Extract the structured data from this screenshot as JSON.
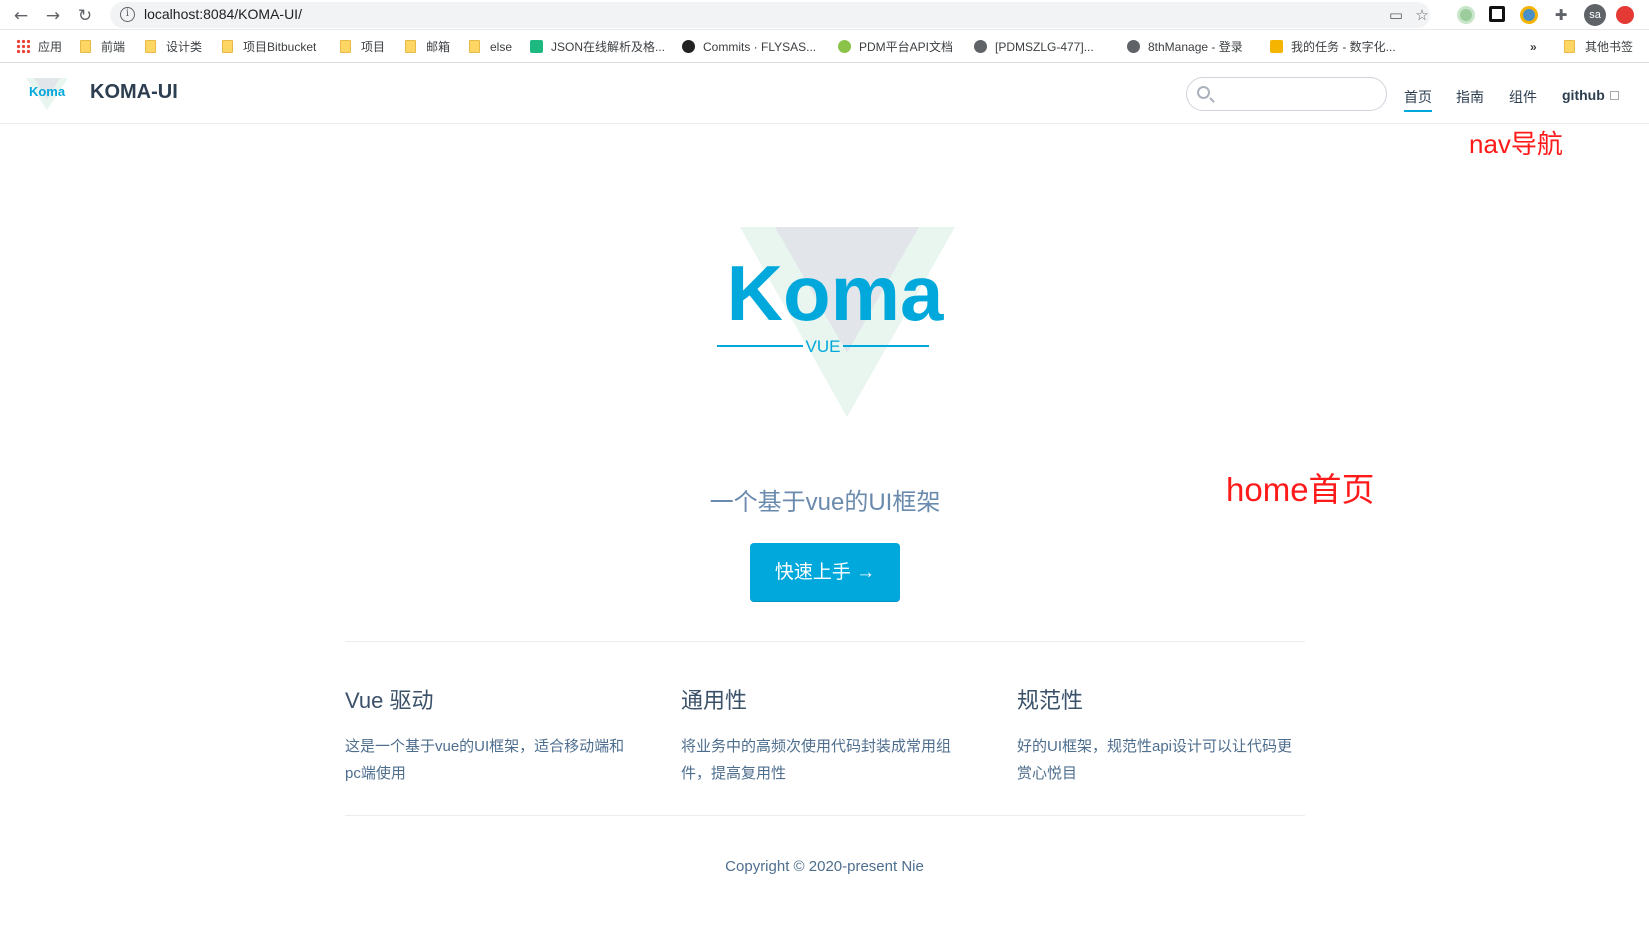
{
  "browser": {
    "url": "localhost:8084/KOMA-UI/",
    "bookmarks": [
      {
        "label": "应用",
        "icon": "apps-icon"
      },
      {
        "label": "前端",
        "icon": "folder-icon"
      },
      {
        "label": "设计类",
        "icon": "folder-icon"
      },
      {
        "label": "项目Bitbucket",
        "icon": "folder-icon"
      },
      {
        "label": "项目",
        "icon": "folder-icon"
      },
      {
        "label": "邮箱",
        "icon": "folder-icon"
      },
      {
        "label": "else",
        "icon": "folder-icon"
      },
      {
        "label": "JSON在线解析及格...",
        "icon": "json-icon"
      },
      {
        "label": "Commits · FLYSAS...",
        "icon": "github-icon"
      },
      {
        "label": "PDM平台API文档",
        "icon": "globe-icon"
      },
      {
        "label": "[PDMSZLG-477]...",
        "icon": "globe-icon"
      },
      {
        "label": "8thManage - 登录",
        "icon": "globe-icon"
      },
      {
        "label": "我的任务 - 数字化...",
        "icon": "task-icon"
      }
    ],
    "more_bookmarks": "»",
    "other_bookmarks": "其他书签",
    "profile_initials": "sa"
  },
  "nav": {
    "site_name": "KOMA-UI",
    "logo_text": "Koma",
    "links": [
      {
        "label": "首页",
        "active": true
      },
      {
        "label": "指南",
        "active": false
      },
      {
        "label": "组件",
        "active": false
      },
      {
        "label": "github",
        "external": true
      }
    ]
  },
  "annotations": {
    "nav": "nav导航",
    "home": "home首页"
  },
  "hero": {
    "logo_text": "Koma",
    "logo_subtext": "VUE",
    "tagline": "一个基于vue的UI框架",
    "action_label": "快速上手 →"
  },
  "features": [
    {
      "title": "Vue 驱动",
      "details": "这是一个基于vue的UI框架，适合移动端和pc端使用"
    },
    {
      "title": "通用性",
      "details": "将业务中的高频次使用代码封装成常用组件，提高复用性"
    },
    {
      "title": "规范性",
      "details": "好的UI框架，规范性api设计可以让代码更赏心悦目"
    }
  ],
  "footer": "Copyright © 2020-present Nie",
  "colors": {
    "accent": "#00a8dc",
    "annotation": "#ff1a1a",
    "logo_v": "#e2e6ea",
    "logo_v_light": "#e8f6ef"
  }
}
